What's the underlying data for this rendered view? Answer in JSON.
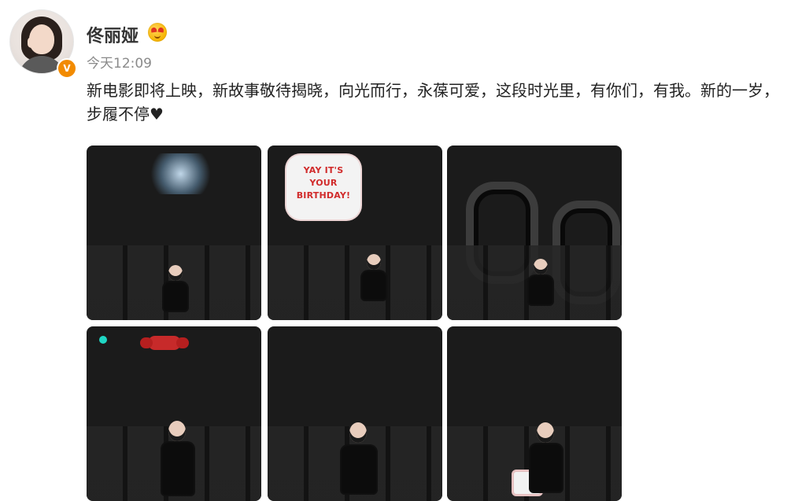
{
  "post": {
    "author_name": "佟丽娅",
    "time_text": "今天12:09",
    "content_text": "新电影即将上映，新故事敬待揭晓，向光而行，永葆可爱，这段时光里，有你们，有我。新的一岁，步履不停",
    "content_tail_icon": "heart",
    "photos": [
      {
        "name": "photo-1"
      },
      {
        "name": "photo-2",
        "balloon_text": "YAY IT'S YOUR BIRTHDAY!"
      },
      {
        "name": "photo-3"
      },
      {
        "name": "photo-4"
      },
      {
        "name": "photo-5"
      },
      {
        "name": "photo-6"
      }
    ]
  },
  "icons": {
    "verified_badge": "verified-badge-icon",
    "emoji_badge": "love-eyes-emoji-icon"
  },
  "colors": {
    "verified": "#f28b00",
    "time": "#8a8a8a",
    "text": "#222222"
  }
}
